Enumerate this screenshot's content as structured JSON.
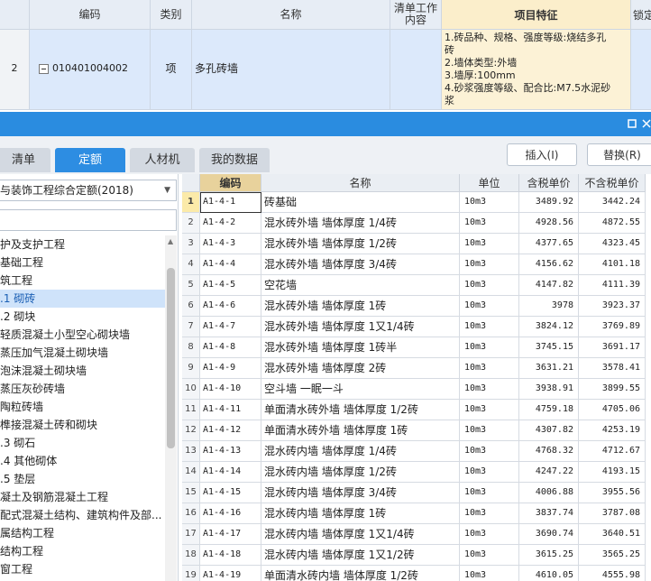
{
  "top_grid": {
    "headers": {
      "code": "编码",
      "type": "类别",
      "name": "名称",
      "content_line1": "清单工作",
      "content_line2": "内容",
      "feature": "项目特征",
      "lock": "锁定"
    },
    "row": {
      "index": "2",
      "code": "010401004002",
      "type": "项",
      "name": "多孔砖墙",
      "feature_lines": [
        "1.砖品种、规格、强度等级:烧结多孔",
        "砖",
        "2.墙体类型:外墙",
        "3.墙厚:100mm",
        "4.砂浆强度等级、配合比:M7.5水泥砂",
        "浆"
      ]
    }
  },
  "tabs": [
    {
      "label": "清单",
      "active": false
    },
    {
      "label": "定额",
      "active": true
    },
    {
      "label": "人材机",
      "active": false
    },
    {
      "label": "我的数据",
      "active": false
    }
  ],
  "actions": {
    "insert": "插入(I)",
    "replace": "替换(R)"
  },
  "left_panel": {
    "quota_book": "与装饰工程综合定额(2018)",
    "tree": [
      {
        "label": "护及支护工程",
        "selected": false
      },
      {
        "label": "基础工程",
        "selected": false
      },
      {
        "label": "筑工程",
        "selected": false
      },
      {
        "label": ".1 砌砖",
        "selected": true
      },
      {
        "label": ".2 砌块",
        "selected": false
      },
      {
        "label": " 轻质混凝土小型空心砌块墙",
        "selected": false
      },
      {
        "label": " 蒸压加气混凝土砌块墙",
        "selected": false
      },
      {
        "label": " 泡沫混凝土砌块墙",
        "selected": false
      },
      {
        "label": " 蒸压灰砂砖墙",
        "selected": false
      },
      {
        "label": " 陶粒砖墙",
        "selected": false
      },
      {
        "label": " 榫接混凝土砖和砌块",
        "selected": false
      },
      {
        "label": ".3 砌石",
        "selected": false
      },
      {
        "label": ".4 其他砌体",
        "selected": false
      },
      {
        "label": ".5 垫层",
        "selected": false
      },
      {
        "label": "凝土及钢筋混凝土工程",
        "selected": false
      },
      {
        "label": "配式混凝土结构、建筑构件及部...",
        "selected": false
      },
      {
        "label": "属结构工程",
        "selected": false
      },
      {
        "label": "结构工程",
        "selected": false
      },
      {
        "label": "窗工程",
        "selected": false
      }
    ]
  },
  "grid": {
    "headers": {
      "code": "编码",
      "name": "名称",
      "unit": "单位",
      "tax_price": "含税单价",
      "notax_price": "不含税单价"
    },
    "rows": [
      {
        "i": "1",
        "code": "A1-4-1",
        "name": "砖基础",
        "unit": "10m3",
        "tax": "3489.92",
        "notax": "3442.24"
      },
      {
        "i": "2",
        "code": "A1-4-2",
        "name": "混水砖外墙 墙体厚度 1/4砖",
        "unit": "10m3",
        "tax": "4928.56",
        "notax": "4872.55"
      },
      {
        "i": "3",
        "code": "A1-4-3",
        "name": "混水砖外墙 墙体厚度 1/2砖",
        "unit": "10m3",
        "tax": "4377.65",
        "notax": "4323.45"
      },
      {
        "i": "4",
        "code": "A1-4-4",
        "name": "混水砖外墙 墙体厚度 3/4砖",
        "unit": "10m3",
        "tax": "4156.62",
        "notax": "4101.18"
      },
      {
        "i": "5",
        "code": "A1-4-5",
        "name": "空花墙",
        "unit": "10m3",
        "tax": "4147.82",
        "notax": "4111.39"
      },
      {
        "i": "6",
        "code": "A1-4-6",
        "name": "混水砖外墙 墙体厚度 1砖",
        "unit": "10m3",
        "tax": "3978",
        "notax": "3923.37"
      },
      {
        "i": "7",
        "code": "A1-4-7",
        "name": "混水砖外墙 墙体厚度 1又1/4砖",
        "unit": "10m3",
        "tax": "3824.12",
        "notax": "3769.89"
      },
      {
        "i": "8",
        "code": "A1-4-8",
        "name": "混水砖外墙 墙体厚度 1砖半",
        "unit": "10m3",
        "tax": "3745.15",
        "notax": "3691.17"
      },
      {
        "i": "9",
        "code": "A1-4-9",
        "name": "混水砖外墙 墙体厚度 2砖",
        "unit": "10m3",
        "tax": "3631.21",
        "notax": "3578.41"
      },
      {
        "i": "10",
        "code": "A1-4-10",
        "name": "空斗墙 一眠一斗",
        "unit": "10m3",
        "tax": "3938.91",
        "notax": "3899.55"
      },
      {
        "i": "11",
        "code": "A1-4-11",
        "name": "单面清水砖外墙 墙体厚度 1/2砖",
        "unit": "10m3",
        "tax": "4759.18",
        "notax": "4705.06"
      },
      {
        "i": "12",
        "code": "A1-4-12",
        "name": "单面清水砖外墙 墙体厚度 1砖",
        "unit": "10m3",
        "tax": "4307.82",
        "notax": "4253.19"
      },
      {
        "i": "13",
        "code": "A1-4-13",
        "name": "混水砖内墙 墙体厚度 1/4砖",
        "unit": "10m3",
        "tax": "4768.32",
        "notax": "4712.67"
      },
      {
        "i": "14",
        "code": "A1-4-14",
        "name": "混水砖内墙 墙体厚度 1/2砖",
        "unit": "10m3",
        "tax": "4247.22",
        "notax": "4193.15"
      },
      {
        "i": "15",
        "code": "A1-4-15",
        "name": "混水砖内墙 墙体厚度 3/4砖",
        "unit": "10m3",
        "tax": "4006.88",
        "notax": "3955.56"
      },
      {
        "i": "16",
        "code": "A1-4-16",
        "name": "混水砖内墙 墙体厚度 1砖",
        "unit": "10m3",
        "tax": "3837.74",
        "notax": "3787.08"
      },
      {
        "i": "17",
        "code": "A1-4-17",
        "name": "混水砖内墙 墙体厚度 1又1/4砖",
        "unit": "10m3",
        "tax": "3690.74",
        "notax": "3640.51"
      },
      {
        "i": "18",
        "code": "A1-4-18",
        "name": "混水砖内墙 墙体厚度 1又1/2砖",
        "unit": "10m3",
        "tax": "3615.25",
        "notax": "3565.25"
      },
      {
        "i": "19",
        "code": "A1-4-19",
        "name": "单面清水砖内墙 墙体厚度 1/2砖",
        "unit": "10m3",
        "tax": "4610.05",
        "notax": "4555.98"
      }
    ]
  }
}
